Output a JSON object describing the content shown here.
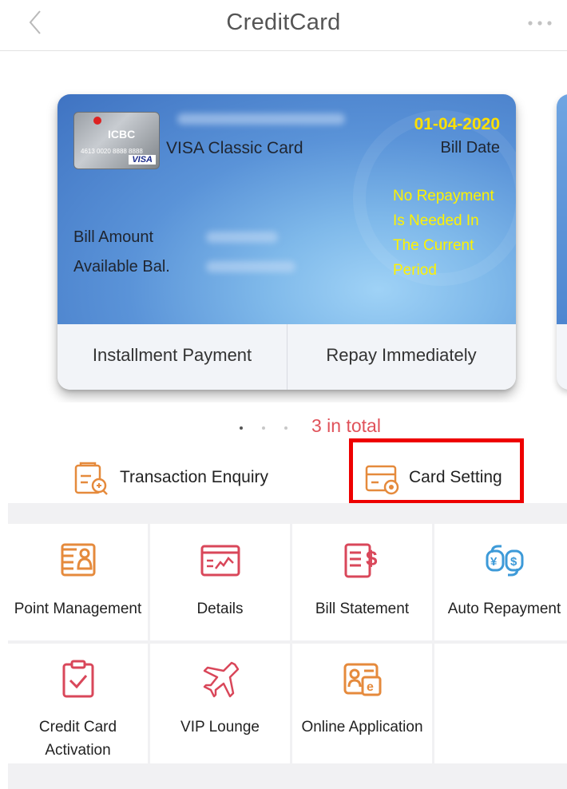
{
  "header": {
    "title": "CreditCard",
    "back_icon": "chevron-left-icon",
    "more_icon": "more-dots-icon"
  },
  "card": {
    "chip_bank": "ICBC",
    "chip_number": "4613 0020 8888 8888",
    "chip_brand": "VISA",
    "name": "VISA Classic Card",
    "bill_date_value": "01-04-2020",
    "bill_date_label": "Bill Date",
    "bill_amount_label": "Bill Amount",
    "available_label": "Available Bal.",
    "notice": "No Repayment Is Needed In The Current Period",
    "installment_button": "Installment Payment",
    "repay_button": "Repay Immediately"
  },
  "pager": {
    "total": "3 in total",
    "active_index": 0,
    "count": 3
  },
  "quick_actions": [
    {
      "label": "Transaction Enquiry",
      "icon": "transaction-enquiry-icon"
    },
    {
      "label": "Card Setting",
      "icon": "card-setting-icon"
    }
  ],
  "grid": [
    {
      "label": "Point Management",
      "icon": "points-icon"
    },
    {
      "label": "Details",
      "icon": "details-icon"
    },
    {
      "label": "Bill Statement",
      "icon": "bill-statement-icon"
    },
    {
      "label": "Auto Repayment",
      "icon": "auto-repayment-icon"
    },
    {
      "label": "Credit Card Activation",
      "label_line1": "Credit Card",
      "label_line2": "Activation",
      "icon": "card-activation-icon"
    },
    {
      "label": "VIP Lounge",
      "icon": "airplane-icon"
    },
    {
      "label": "Online Application",
      "icon": "online-application-icon"
    }
  ],
  "colors": {
    "accent_orange": "#e58a3c",
    "accent_red": "#e0525a",
    "highlight": "#ee0000",
    "icon_blue": "#3d9ad8",
    "notice_yellow": "#fff200"
  }
}
